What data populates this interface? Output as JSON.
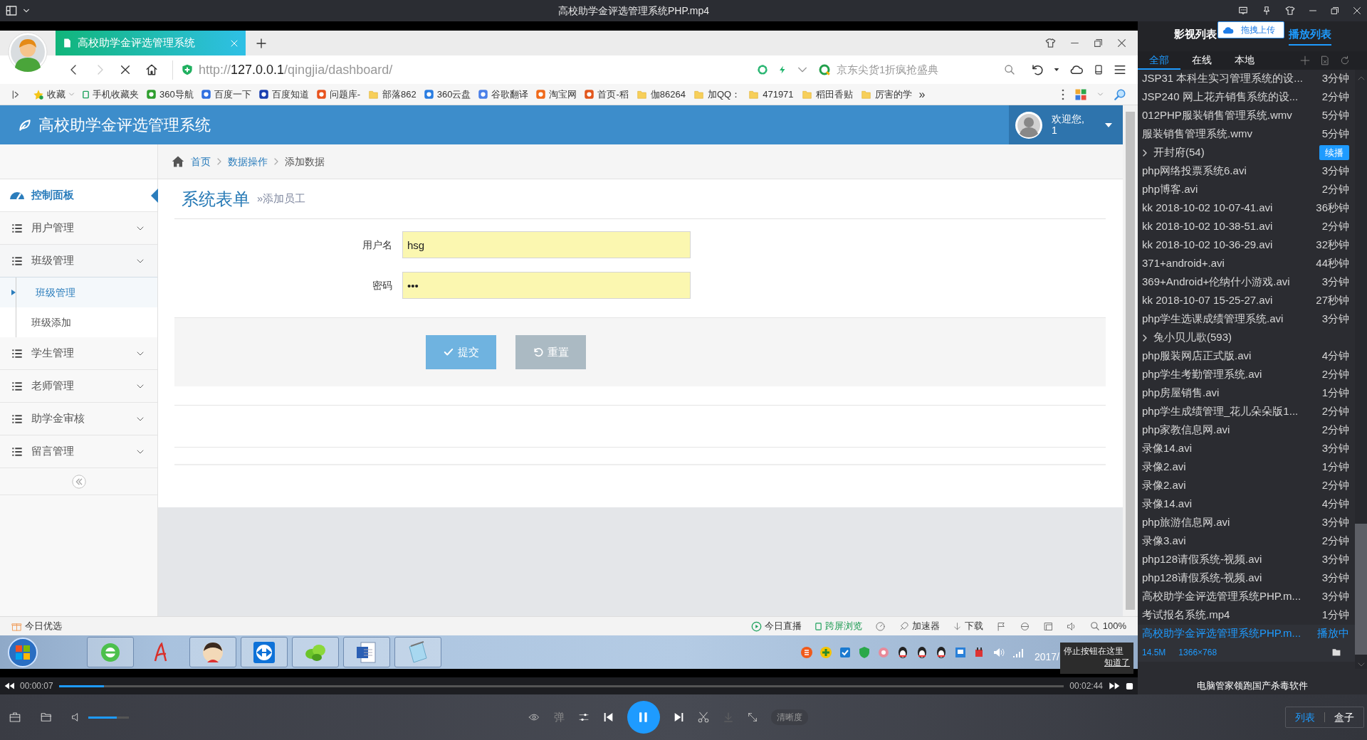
{
  "player": {
    "title": "高校助学金评选管理系统PHP.mp4"
  },
  "browser": {
    "tab_title": "高校助学金评选管理系统",
    "url": {
      "scheme": "http://",
      "host": "127.0.0.1",
      "path": "/qingjia/dashboard/"
    },
    "search_placeholder": "京东尖货1折疯抢盛典",
    "bookmarks": [
      {
        "kind": "star",
        "label": "收藏"
      },
      {
        "kind": "phone",
        "label": "手机收藏夹"
      },
      {
        "kind": "site",
        "label": "360导航",
        "color": "#2e9e2e"
      },
      {
        "kind": "site",
        "label": "百度一下",
        "color": "#2f6fe0"
      },
      {
        "kind": "site",
        "label": "百度知道",
        "color": "#1a3fb0"
      },
      {
        "kind": "site",
        "label": "问题库-",
        "color": "#e8531e"
      },
      {
        "kind": "folder",
        "label": "部落862"
      },
      {
        "kind": "site",
        "label": "360云盘",
        "color": "#2a7de1"
      },
      {
        "kind": "site",
        "label": "谷歌翻译",
        "color": "#4a7fe8"
      },
      {
        "kind": "site",
        "label": "淘宝网",
        "color": "#f06a1a"
      },
      {
        "kind": "site",
        "label": "首页-稻",
        "color": "#e2561c"
      },
      {
        "kind": "folder",
        "label": "伽86264"
      },
      {
        "kind": "folder",
        "label": "加QQ："
      },
      {
        "kind": "folder",
        "label": "471971"
      },
      {
        "kind": "folder",
        "label": "稻田香贴"
      },
      {
        "kind": "folder",
        "label": "厉害的学"
      }
    ],
    "bookmarks_more": "»",
    "status_left": "今日优选",
    "status_items": [
      {
        "kind": "live",
        "label": "今日直播"
      },
      {
        "kind": "cross-screen",
        "label": "跨屏浏览"
      },
      {
        "kind": "accelerator",
        "label": "加速器"
      },
      {
        "kind": "download",
        "label": "下载"
      },
      {
        "kind": "zoom",
        "label": "100%"
      }
    ]
  },
  "app": {
    "title": "高校助学金评选管理系统",
    "welcome": "欢迎您,",
    "user": "1"
  },
  "breadcrumb": [
    {
      "label": "首页",
      "current": false
    },
    {
      "label": "数据操作",
      "current": false
    },
    {
      "label": "添加数据",
      "current": true
    }
  ],
  "sidebar": [
    {
      "kind": "dashboard",
      "label": "控制面板",
      "selected": true
    },
    {
      "kind": "menu",
      "label": "用户管理",
      "selected": false,
      "expanded": false
    },
    {
      "kind": "menu",
      "label": "班级管理",
      "selected": false,
      "expanded": true,
      "children": [
        {
          "label": "班级管理",
          "selected": true
        },
        {
          "label": "班级添加",
          "selected": false
        }
      ]
    },
    {
      "kind": "menu",
      "label": "学生管理",
      "selected": false,
      "expanded": false
    },
    {
      "kind": "menu",
      "label": "老师管理",
      "selected": false,
      "expanded": false
    },
    {
      "kind": "menu",
      "label": "助学金审核",
      "selected": false,
      "expanded": false
    },
    {
      "kind": "menu",
      "label": "留言管理",
      "selected": false,
      "expanded": false
    }
  ],
  "page_title": "系统表单",
  "page_subtitle": "»添加员工",
  "form": {
    "fields": [
      {
        "label": "用户名",
        "value": "hsg",
        "autofilled": true
      },
      {
        "label": "密码",
        "value": "•••",
        "autofilled": true
      }
    ],
    "buttons": [
      {
        "kind": "submit",
        "label": "提交"
      },
      {
        "kind": "reset",
        "label": "重置"
      }
    ]
  },
  "taskbar": {
    "clock": "2017/",
    "tooltip": {
      "text": "停止按钮在这里",
      "link": "知道了"
    }
  },
  "seek": {
    "elapsed": "00:00:07",
    "total": "00:02:44",
    "level": 0.045
  },
  "controls": {
    "volume": {
      "level": 0.7
    },
    "danmaku": "弹",
    "quality": "清晰度",
    "views": [
      {
        "label": "列表",
        "selected": true
      },
      {
        "label": "盒子",
        "selected": false
      }
    ]
  },
  "panel": {
    "tabs": [
      {
        "label": "影视列表",
        "selected": false
      },
      {
        "label": "播放列表",
        "selected": true
      }
    ],
    "upload_hint": "拖拽上传",
    "filters": [
      {
        "label": "全部",
        "selected": true
      },
      {
        "label": "在线",
        "selected": false
      },
      {
        "label": "本地",
        "selected": false
      }
    ],
    "items": [
      {
        "kind": "file",
        "name": "JSP31 本科生实习管理系统的设...",
        "duration": "3分钟",
        "playing": false
      },
      {
        "kind": "file",
        "name": "JSP240 网上花卉销售系统的设...",
        "duration": "2分钟",
        "playing": false
      },
      {
        "kind": "file",
        "name": "012PHP服装销售管理系统.wmv",
        "duration": "5分钟",
        "playing": false
      },
      {
        "kind": "file",
        "name": "服装销售管理系统.wmv",
        "duration": "5分钟",
        "playing": false
      },
      {
        "kind": "group",
        "name": "开封府(54)",
        "badge": "续播"
      },
      {
        "kind": "file",
        "name": "php网络投票系统6.avi",
        "duration": "3分钟",
        "playing": false
      },
      {
        "kind": "file",
        "name": "php博客.avi",
        "duration": "2分钟",
        "playing": false
      },
      {
        "kind": "file",
        "name": "kk 2018-10-02 10-07-41.avi",
        "duration": "36秒钟",
        "playing": false
      },
      {
        "kind": "file",
        "name": "kk 2018-10-02 10-38-51.avi",
        "duration": "2分钟",
        "playing": false
      },
      {
        "kind": "file",
        "name": "kk 2018-10-02 10-36-29.avi",
        "duration": "32秒钟",
        "playing": false
      },
      {
        "kind": "file",
        "name": "371+android+.avi",
        "duration": "44秒钟",
        "playing": false
      },
      {
        "kind": "file",
        "name": "369+Android+伦纳什小游戏.avi",
        "duration": "3分钟",
        "playing": false
      },
      {
        "kind": "file",
        "name": "kk 2018-10-07 15-25-27.avi",
        "duration": "27秒钟",
        "playing": false
      },
      {
        "kind": "file",
        "name": "php学生选课成绩管理系统.avi",
        "duration": "3分钟",
        "playing": false
      },
      {
        "kind": "group",
        "name": "兔小贝儿歌(593)"
      },
      {
        "kind": "file",
        "name": "php服装网店正式版.avi",
        "duration": "4分钟",
        "playing": false
      },
      {
        "kind": "file",
        "name": "php学生考勤管理系统.avi",
        "duration": "2分钟",
        "playing": false
      },
      {
        "kind": "file",
        "name": "php房屋销售.avi",
        "duration": "1分钟",
        "playing": false
      },
      {
        "kind": "file",
        "name": "php学生成绩管理_花儿朵朵版1...",
        "duration": "2分钟",
        "playing": false
      },
      {
        "kind": "file",
        "name": "php家教信息网.avi",
        "duration": "2分钟",
        "playing": false
      },
      {
        "kind": "file",
        "name": "录像14.avi",
        "duration": "3分钟",
        "playing": false
      },
      {
        "kind": "file",
        "name": "录像2.avi",
        "duration": "1分钟",
        "playing": false
      },
      {
        "kind": "file",
        "name": "录像2.avi",
        "duration": "2分钟",
        "playing": false
      },
      {
        "kind": "file",
        "name": "录像14.avi",
        "duration": "4分钟",
        "playing": false
      },
      {
        "kind": "file",
        "name": "php旅游信息网.avi",
        "duration": "3分钟",
        "playing": false
      },
      {
        "kind": "file",
        "name": "录像3.avi",
        "duration": "2分钟",
        "playing": false
      },
      {
        "kind": "file",
        "name": "php128请假系统-视频.avi",
        "duration": "3分钟",
        "playing": false
      },
      {
        "kind": "file",
        "name": "php128请假系统-视频.avi",
        "duration": "3分钟",
        "playing": false
      },
      {
        "kind": "file",
        "name": "高校助学金评选管理系统PHP.m...",
        "duration": "3分钟",
        "playing": false
      },
      {
        "kind": "file",
        "name": "考试报名系统.mp4",
        "duration": "1分钟",
        "playing": false
      },
      {
        "kind": "file",
        "name": "高校助学金评选管理系统PHP.m...",
        "status": "播放中",
        "playing": true,
        "size": "14.5M",
        "resolution": "1366×768"
      }
    ],
    "ad": "电脑管家领跑国产杀毒软件"
  }
}
